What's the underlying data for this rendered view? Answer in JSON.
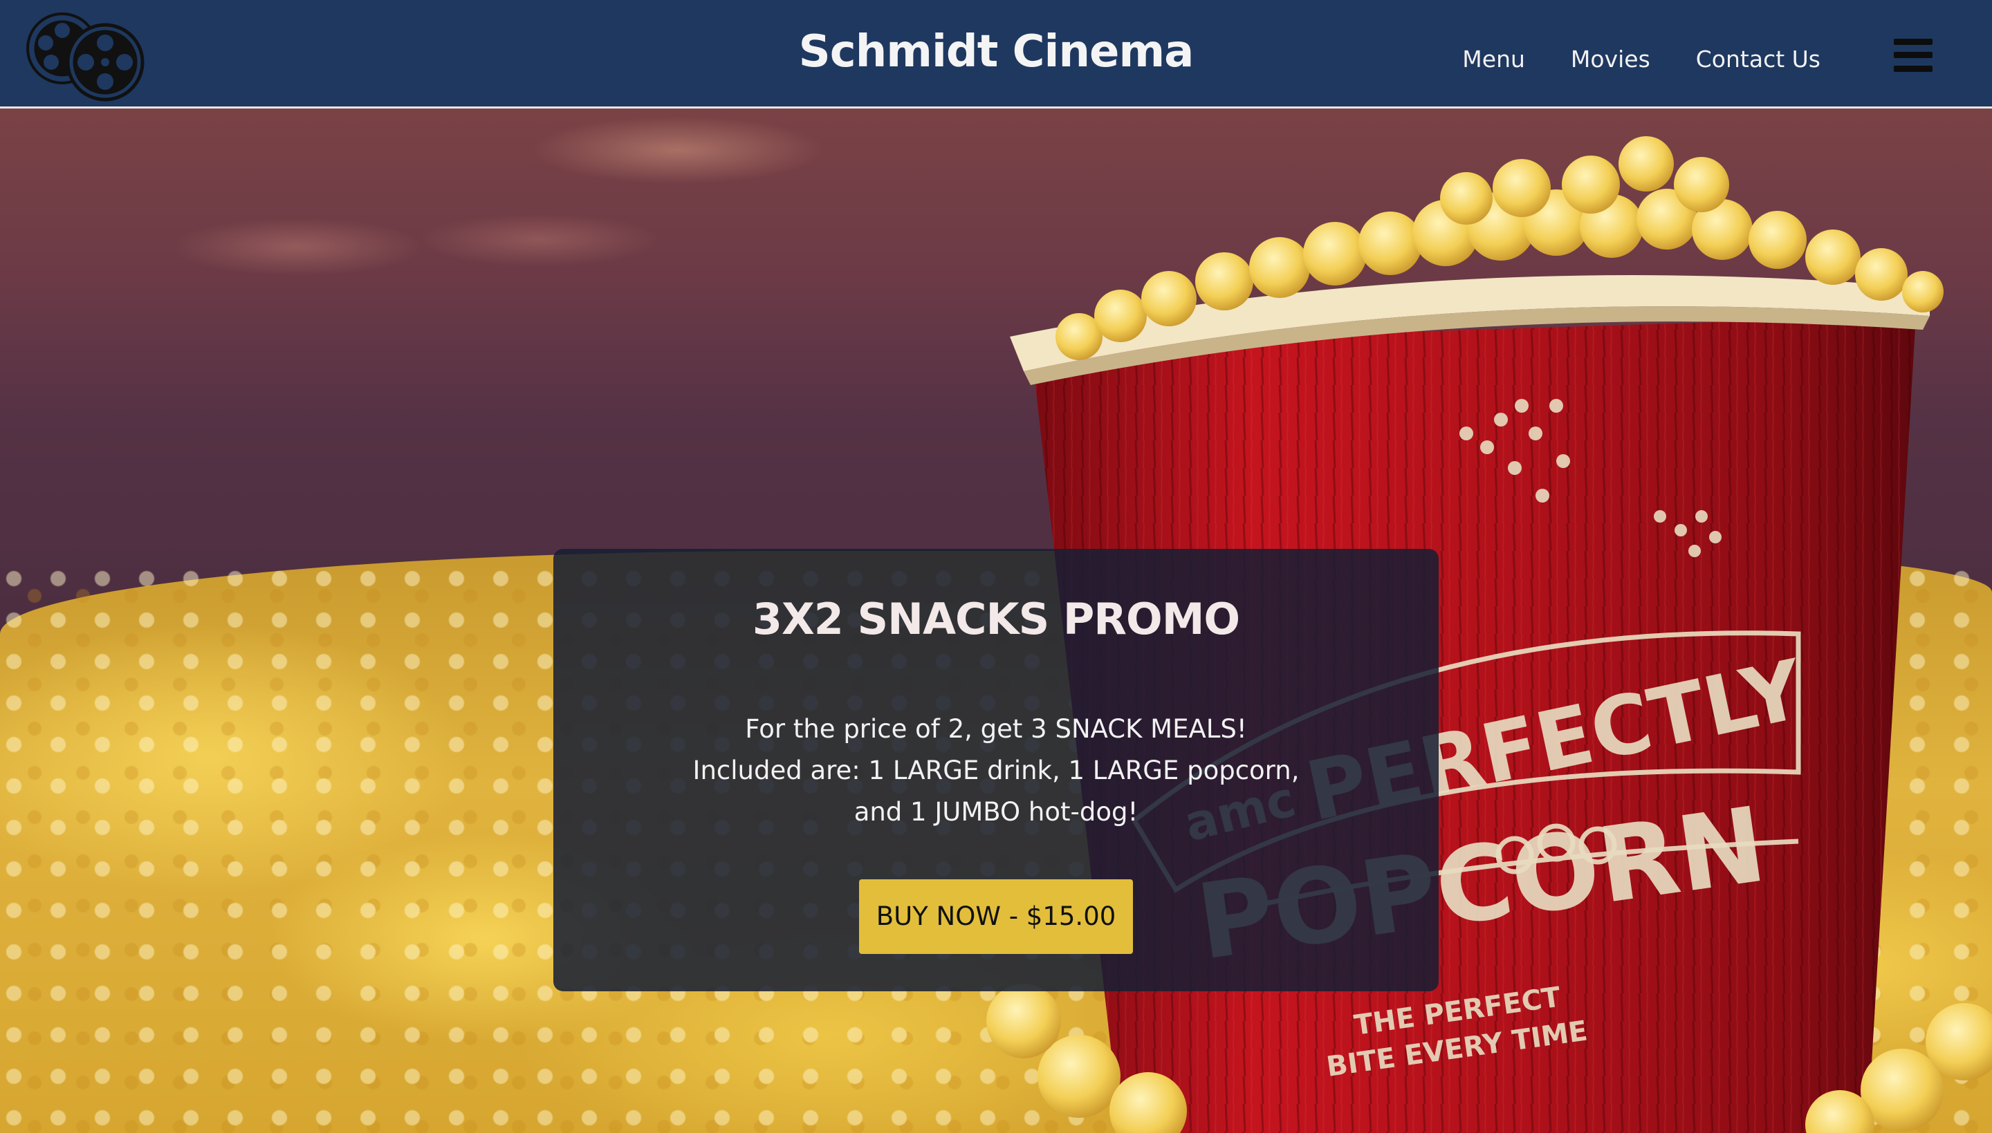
{
  "header": {
    "brand": "Schmidt Cinema",
    "logo_icon": "film-reels-icon",
    "nav": [
      {
        "label": "Menu"
      },
      {
        "label": "Movies"
      },
      {
        "label": "Contact Us"
      }
    ],
    "menu_icon": "hamburger-menu-icon"
  },
  "hero": {
    "background": "popcorn-bucket-photo",
    "bucket_text": {
      "brand": "amc",
      "line1": "PERFECTLY",
      "line2": "POPCORN",
      "tagline1": "THE PERFECT",
      "tagline2": "BITE EVERY TIME"
    }
  },
  "promo": {
    "title": "3X2 SNACKS PROMO",
    "body_lines": [
      "For the price of 2, get 3 SNACK MEALS!",
      "Included are: 1 LARGE drink, 1 LARGE popcorn,",
      "and 1 JUMBO hot-dog!"
    ],
    "button_label": "BUY NOW - $15.00"
  },
  "colors": {
    "header_bg": "#1e3860",
    "card_bg": "#161e34",
    "button_bg": "#e2be3b",
    "bucket_red": "#b8121c",
    "text_light": "#f2f2f2"
  }
}
